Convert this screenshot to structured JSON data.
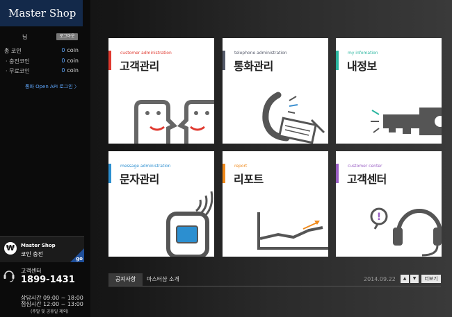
{
  "brand": {
    "logo": "Master Shop"
  },
  "user": {
    "suffix": "님",
    "logout_label": "로그아웃"
  },
  "coins": {
    "total_label": "총 코인",
    "total_value": "0",
    "unit": "coin",
    "charged_label": "· 충전코인",
    "charged_value": "0",
    "free_label": "· 무료코인",
    "free_value": "0"
  },
  "api_link": "통화 Open API 로그인 〉",
  "charge": {
    "title": "Master Shop",
    "subtitle": "코인 충전",
    "go": "go",
    "icon": "won-icon"
  },
  "support": {
    "label": "고객센터",
    "phone": "1899-1431",
    "hours_1": "상담시간 09:00 ~ 18:00",
    "hours_2": "점심시간 12:00 ~ 13:00",
    "note": "(주말 및 공휴일 제외)",
    "icon": "headset-icon"
  },
  "tiles": [
    {
      "en": "customer administration",
      "ko": "고객관리",
      "accent": "#e0392f",
      "icon": "faces-icon"
    },
    {
      "en": "telephone administration",
      "ko": "통화관리",
      "accent": "#555a6a",
      "icon": "telephone-icon"
    },
    {
      "en": "my infomation",
      "ko": "내정보",
      "accent": "#2bb6a0",
      "icon": "key-icon"
    },
    {
      "en": "message administration",
      "ko": "문자관리",
      "accent": "#2c8fd0",
      "icon": "mobile-phone-icon"
    },
    {
      "en": "report",
      "ko": "리포트",
      "accent": "#f08a1c",
      "icon": "report-chart-icon"
    },
    {
      "en": "customer center",
      "ko": "고객센터",
      "accent": "#9a5fc4",
      "icon": "headset-question-icon"
    }
  ],
  "notice": {
    "tab_active": "공지사항",
    "tab_other": "마스터샵 소개",
    "date": "2014.09.22",
    "up": "▲",
    "down": "▼",
    "more": "더보기"
  }
}
